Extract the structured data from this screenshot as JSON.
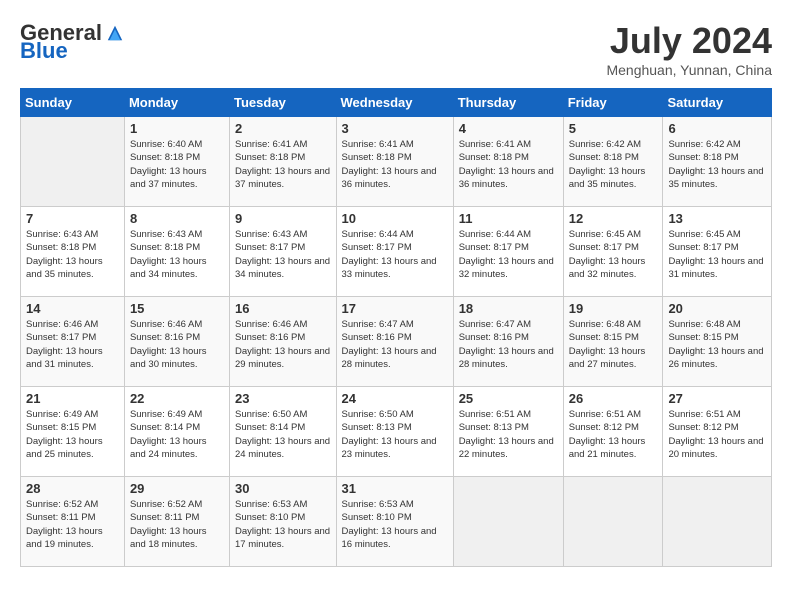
{
  "header": {
    "logo_general": "General",
    "logo_blue": "Blue",
    "month_title": "July 2024",
    "subtitle": "Menghuan, Yunnan, China"
  },
  "days_of_week": [
    "Sunday",
    "Monday",
    "Tuesday",
    "Wednesday",
    "Thursday",
    "Friday",
    "Saturday"
  ],
  "weeks": [
    [
      {
        "day": "",
        "empty": true
      },
      {
        "day": "1",
        "sunrise": "Sunrise: 6:40 AM",
        "sunset": "Sunset: 8:18 PM",
        "daylight": "Daylight: 13 hours and 37 minutes."
      },
      {
        "day": "2",
        "sunrise": "Sunrise: 6:41 AM",
        "sunset": "Sunset: 8:18 PM",
        "daylight": "Daylight: 13 hours and 37 minutes."
      },
      {
        "day": "3",
        "sunrise": "Sunrise: 6:41 AM",
        "sunset": "Sunset: 8:18 PM",
        "daylight": "Daylight: 13 hours and 36 minutes."
      },
      {
        "day": "4",
        "sunrise": "Sunrise: 6:41 AM",
        "sunset": "Sunset: 8:18 PM",
        "daylight": "Daylight: 13 hours and 36 minutes."
      },
      {
        "day": "5",
        "sunrise": "Sunrise: 6:42 AM",
        "sunset": "Sunset: 8:18 PM",
        "daylight": "Daylight: 13 hours and 35 minutes."
      },
      {
        "day": "6",
        "sunrise": "Sunrise: 6:42 AM",
        "sunset": "Sunset: 8:18 PM",
        "daylight": "Daylight: 13 hours and 35 minutes."
      }
    ],
    [
      {
        "day": "7",
        "sunrise": "Sunrise: 6:43 AM",
        "sunset": "Sunset: 8:18 PM",
        "daylight": "Daylight: 13 hours and 35 minutes."
      },
      {
        "day": "8",
        "sunrise": "Sunrise: 6:43 AM",
        "sunset": "Sunset: 8:18 PM",
        "daylight": "Daylight: 13 hours and 34 minutes."
      },
      {
        "day": "9",
        "sunrise": "Sunrise: 6:43 AM",
        "sunset": "Sunset: 8:17 PM",
        "daylight": "Daylight: 13 hours and 34 minutes."
      },
      {
        "day": "10",
        "sunrise": "Sunrise: 6:44 AM",
        "sunset": "Sunset: 8:17 PM",
        "daylight": "Daylight: 13 hours and 33 minutes."
      },
      {
        "day": "11",
        "sunrise": "Sunrise: 6:44 AM",
        "sunset": "Sunset: 8:17 PM",
        "daylight": "Daylight: 13 hours and 32 minutes."
      },
      {
        "day": "12",
        "sunrise": "Sunrise: 6:45 AM",
        "sunset": "Sunset: 8:17 PM",
        "daylight": "Daylight: 13 hours and 32 minutes."
      },
      {
        "day": "13",
        "sunrise": "Sunrise: 6:45 AM",
        "sunset": "Sunset: 8:17 PM",
        "daylight": "Daylight: 13 hours and 31 minutes."
      }
    ],
    [
      {
        "day": "14",
        "sunrise": "Sunrise: 6:46 AM",
        "sunset": "Sunset: 8:17 PM",
        "daylight": "Daylight: 13 hours and 31 minutes."
      },
      {
        "day": "15",
        "sunrise": "Sunrise: 6:46 AM",
        "sunset": "Sunset: 8:16 PM",
        "daylight": "Daylight: 13 hours and 30 minutes."
      },
      {
        "day": "16",
        "sunrise": "Sunrise: 6:46 AM",
        "sunset": "Sunset: 8:16 PM",
        "daylight": "Daylight: 13 hours and 29 minutes."
      },
      {
        "day": "17",
        "sunrise": "Sunrise: 6:47 AM",
        "sunset": "Sunset: 8:16 PM",
        "daylight": "Daylight: 13 hours and 28 minutes."
      },
      {
        "day": "18",
        "sunrise": "Sunrise: 6:47 AM",
        "sunset": "Sunset: 8:16 PM",
        "daylight": "Daylight: 13 hours and 28 minutes."
      },
      {
        "day": "19",
        "sunrise": "Sunrise: 6:48 AM",
        "sunset": "Sunset: 8:15 PM",
        "daylight": "Daylight: 13 hours and 27 minutes."
      },
      {
        "day": "20",
        "sunrise": "Sunrise: 6:48 AM",
        "sunset": "Sunset: 8:15 PM",
        "daylight": "Daylight: 13 hours and 26 minutes."
      }
    ],
    [
      {
        "day": "21",
        "sunrise": "Sunrise: 6:49 AM",
        "sunset": "Sunset: 8:15 PM",
        "daylight": "Daylight: 13 hours and 25 minutes."
      },
      {
        "day": "22",
        "sunrise": "Sunrise: 6:49 AM",
        "sunset": "Sunset: 8:14 PM",
        "daylight": "Daylight: 13 hours and 24 minutes."
      },
      {
        "day": "23",
        "sunrise": "Sunrise: 6:50 AM",
        "sunset": "Sunset: 8:14 PM",
        "daylight": "Daylight: 13 hours and 24 minutes."
      },
      {
        "day": "24",
        "sunrise": "Sunrise: 6:50 AM",
        "sunset": "Sunset: 8:13 PM",
        "daylight": "Daylight: 13 hours and 23 minutes."
      },
      {
        "day": "25",
        "sunrise": "Sunrise: 6:51 AM",
        "sunset": "Sunset: 8:13 PM",
        "daylight": "Daylight: 13 hours and 22 minutes."
      },
      {
        "day": "26",
        "sunrise": "Sunrise: 6:51 AM",
        "sunset": "Sunset: 8:12 PM",
        "daylight": "Daylight: 13 hours and 21 minutes."
      },
      {
        "day": "27",
        "sunrise": "Sunrise: 6:51 AM",
        "sunset": "Sunset: 8:12 PM",
        "daylight": "Daylight: 13 hours and 20 minutes."
      }
    ],
    [
      {
        "day": "28",
        "sunrise": "Sunrise: 6:52 AM",
        "sunset": "Sunset: 8:11 PM",
        "daylight": "Daylight: 13 hours and 19 minutes."
      },
      {
        "day": "29",
        "sunrise": "Sunrise: 6:52 AM",
        "sunset": "Sunset: 8:11 PM",
        "daylight": "Daylight: 13 hours and 18 minutes."
      },
      {
        "day": "30",
        "sunrise": "Sunrise: 6:53 AM",
        "sunset": "Sunset: 8:10 PM",
        "daylight": "Daylight: 13 hours and 17 minutes."
      },
      {
        "day": "31",
        "sunrise": "Sunrise: 6:53 AM",
        "sunset": "Sunset: 8:10 PM",
        "daylight": "Daylight: 13 hours and 16 minutes."
      },
      {
        "day": "",
        "empty": true
      },
      {
        "day": "",
        "empty": true
      },
      {
        "day": "",
        "empty": true
      }
    ]
  ]
}
